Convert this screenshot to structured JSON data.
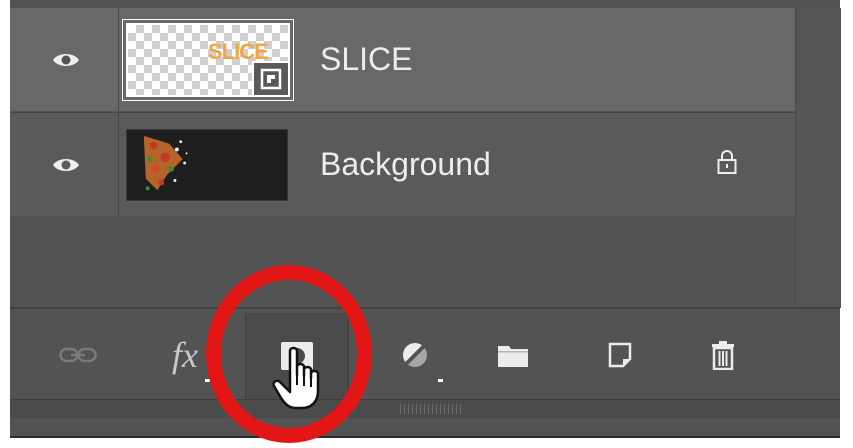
{
  "layers": [
    {
      "name": "SLICE",
      "thumb_text": "SLICE",
      "visible": true,
      "selected": true,
      "smart_object": true,
      "locked": false
    },
    {
      "name": "Background",
      "visible": true,
      "selected": false,
      "locked": true
    }
  ],
  "toolbar": {
    "fx_label": "fx",
    "buttons": [
      "link-layers",
      "add-layer-style",
      "add-layer-mask",
      "new-adjustment-layer",
      "new-group",
      "new-layer",
      "delete-layer"
    ],
    "active_button": "add-layer-mask"
  },
  "colors": {
    "panel": "#535353",
    "selected_row": "#686868",
    "highlight_ring": "#e31616",
    "thumb_text": "#f0a642"
  }
}
